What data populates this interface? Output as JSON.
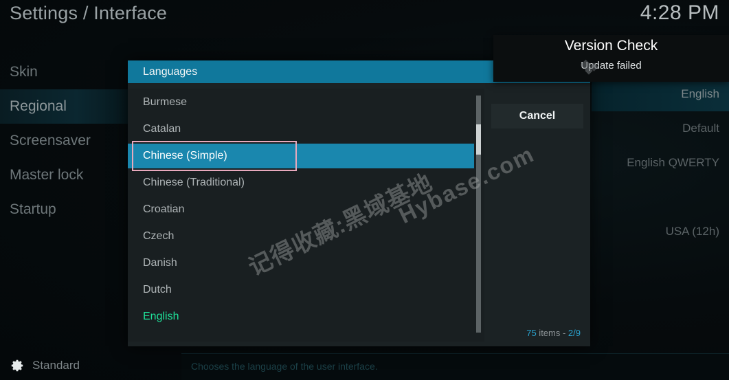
{
  "window": {
    "title": "Settings / Interface",
    "clock": "4:28 PM"
  },
  "sidebar": {
    "items": [
      {
        "label": "Skin",
        "selected": false
      },
      {
        "label": "Regional",
        "selected": true
      },
      {
        "label": "Screensaver",
        "selected": false
      },
      {
        "label": "Master lock",
        "selected": false
      },
      {
        "label": "Startup",
        "selected": false
      }
    ]
  },
  "settings_values": {
    "rows": [
      {
        "value": "English",
        "focused": true
      },
      {
        "value": "Default",
        "focused": false
      },
      {
        "value": "English QWERTY",
        "focused": false
      },
      {
        "value": "",
        "focused": false
      },
      {
        "value": "USA (12h)",
        "focused": false
      }
    ]
  },
  "bottom": {
    "level_icon": "gear-icon",
    "level_label": "Standard",
    "description": "Chooses the language of the user interface."
  },
  "dialog": {
    "title": "Languages",
    "cancel_label": "Cancel",
    "item_count_prefix": "75",
    "item_count_middle": " items - ",
    "item_count_page": "2/9",
    "items": [
      {
        "label": "Burmese",
        "state": "normal"
      },
      {
        "label": "Catalan",
        "state": "normal"
      },
      {
        "label": "Chinese (Simple)",
        "state": "selected"
      },
      {
        "label": "Chinese (Traditional)",
        "state": "normal"
      },
      {
        "label": "Croatian",
        "state": "normal"
      },
      {
        "label": "Czech",
        "state": "normal"
      },
      {
        "label": "Danish",
        "state": "normal"
      },
      {
        "label": "Dutch",
        "state": "normal"
      },
      {
        "label": "English",
        "state": "current"
      }
    ],
    "scrollbar": {
      "position": "2/9"
    }
  },
  "toast": {
    "title": "Version Check",
    "message": "Update failed",
    "logo": "kodi-logo-icon"
  },
  "watermark": {
    "chinese": "记得收藏:黑域基地",
    "english": "Hybase.com"
  },
  "colors": {
    "accent_teal": "#10789c",
    "selection_blue": "#1a87ae",
    "focus_pink": "#e8a9bd",
    "current_green": "#1fe29a",
    "dialog_bg": "#1b2224",
    "list_bg": "#191f21"
  }
}
